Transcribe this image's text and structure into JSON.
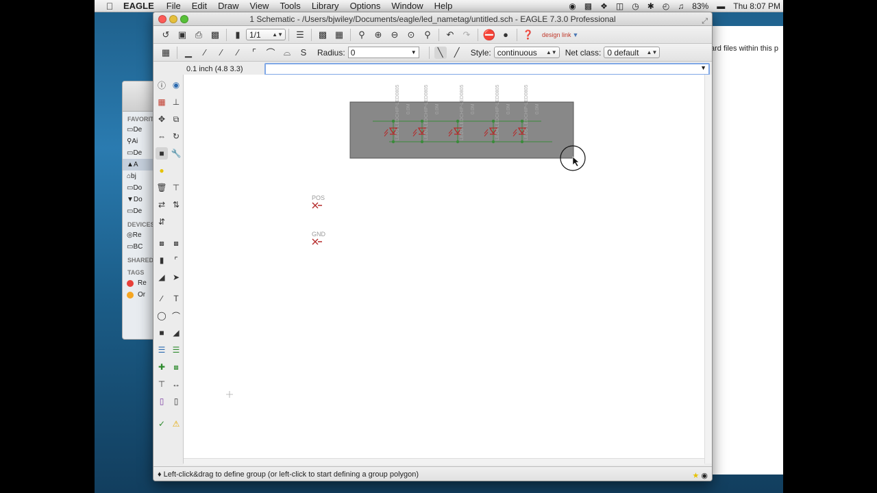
{
  "menubar": {
    "app_name": "EAGLE",
    "items": [
      "File",
      "Edit",
      "Draw",
      "View",
      "Tools",
      "Library",
      "Options",
      "Window",
      "Help"
    ],
    "battery": "83%",
    "clock": "Thu 8:07 PM"
  },
  "finder": {
    "favorites_label": "FAVORIT",
    "favorites": [
      "De",
      "Ai",
      "De",
      "A",
      "bj",
      "Do",
      "Do",
      "De"
    ],
    "devices_label": "DEVICES",
    "devices": [
      "Re",
      "BC"
    ],
    "shared_label": "SHARED",
    "tags_label": "TAGS",
    "tags": [
      "Re",
      "Or"
    ]
  },
  "docwin": {
    "text": "ard files within this p"
  },
  "window": {
    "title": "1 Schematic - /Users/bjwiley/Documents/eagle/led_nametag/untitled.sch - EAGLE 7.3.0 Professional"
  },
  "toolbar1": {
    "sheet_value": "1/1",
    "designlink_label": "design link"
  },
  "toolbar2": {
    "radius_label": "Radius:",
    "radius_value": "0",
    "style_label": "Style:",
    "style_value": "continuous",
    "netclass_label": "Net class:",
    "netclass_value": "0 default"
  },
  "cmdrow": {
    "coordinates": "0.1 inch (4.8 3.3)",
    "command_value": ""
  },
  "schematic": {
    "leds": [
      {
        "name": "LED1",
        "value": "LEDCHIP-LED0805"
      },
      {
        "name": "LED2",
        "value": "LEDCHIP-LED0805"
      },
      {
        "name": "LED3",
        "value": "LEDCHIP-LED0805"
      },
      {
        "name": "LED4",
        "value": "LEDCHIP-LED0805"
      },
      {
        "name": "LED5",
        "value": "LEDCHIP-LED0805"
      }
    ],
    "top_labels": [
      "0.0M",
      "0.0M",
      "0.0M",
      "0.0M",
      "0.0M"
    ],
    "supply_pos": "POS",
    "supply_gnd": "GND"
  },
  "status": {
    "message": "♦ Left-click&drag to define group (or left-click to start defining a group polygon)"
  }
}
